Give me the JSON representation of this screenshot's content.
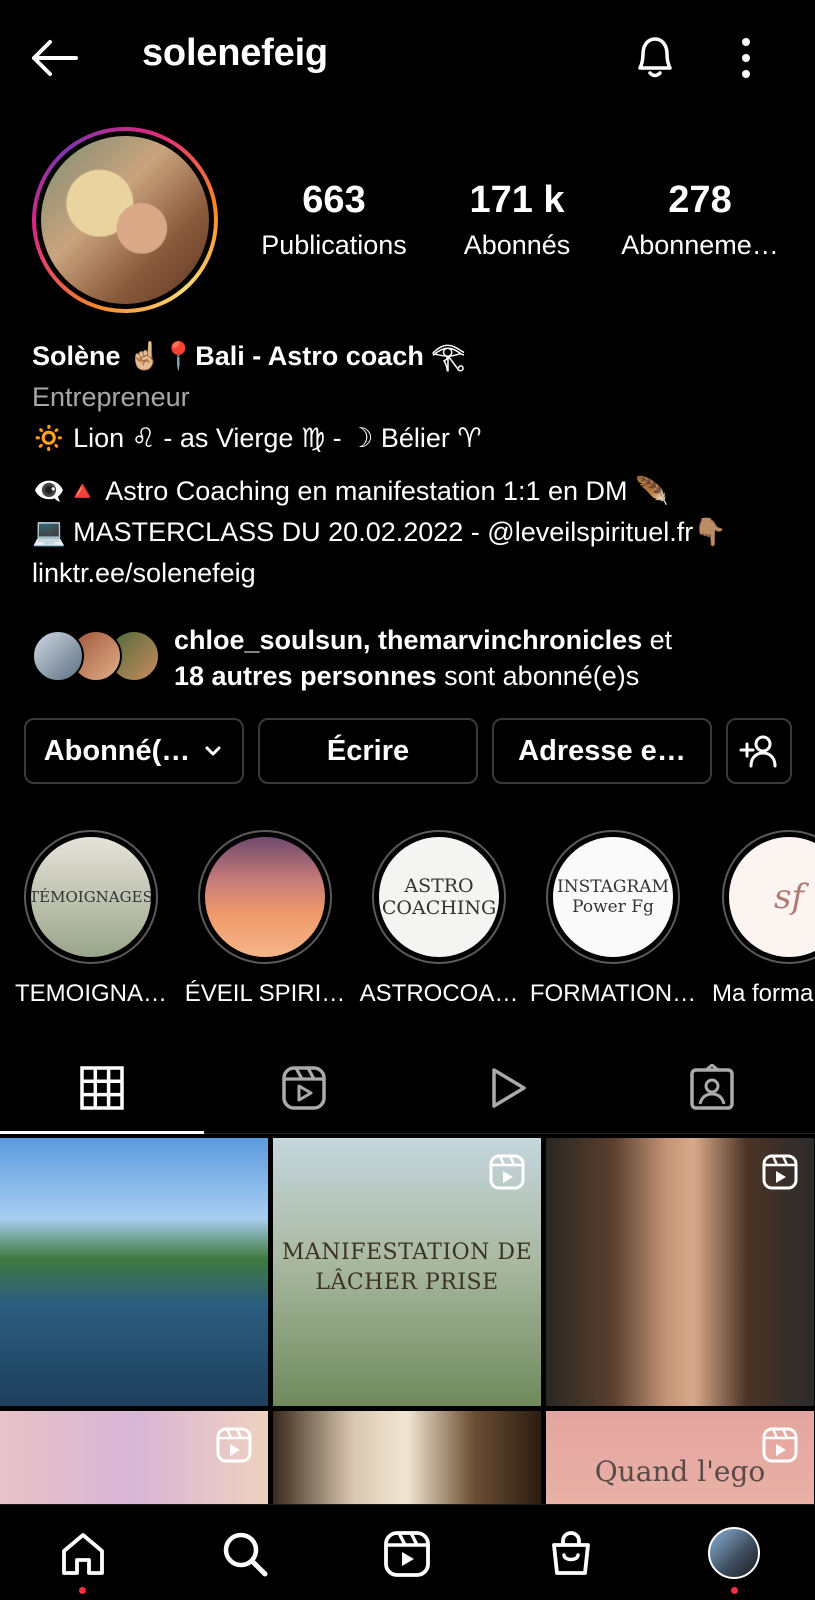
{
  "header": {
    "username": "solenefeig"
  },
  "stats": [
    {
      "value": "663",
      "label": "Publications"
    },
    {
      "value": "171 k",
      "label": "Abonnés"
    },
    {
      "value": "278",
      "label": "Abonneme…"
    }
  ],
  "bio": {
    "name": "Solène ☝🏼📍Bali - Astro coach 𓂀",
    "category": "Entrepreneur",
    "line1": "🔅 Lion ♌ - as Vierge ♍ - ☽ Bélier ♈",
    "line2": "👁‍🗨🔺 Astro Coaching en manifestation 1:1 en DM 🪶",
    "line3": "💻 MASTERCLASS DU 20.02.2022 - @leveilspirituel.fr👇🏽",
    "link": "linktr.ee/solenefeig"
  },
  "followers": {
    "names": "chloe_soulsun, themarvinchronicles",
    "joiner": " et",
    "others": "18 autres personnes",
    "suffix": " sont abonné(e)s"
  },
  "buttons": {
    "following": "Abonné(…",
    "message": "Écrire",
    "email": "Adresse e…"
  },
  "highlights": [
    {
      "label": "TEMOIGNA…",
      "cover_text": "TÉMOIGNAGES"
    },
    {
      "label": "ÉVEIL SPIRI…",
      "cover_text": ""
    },
    {
      "label": "ASTROCOA…",
      "cover_text": "ASTRO COACHING"
    },
    {
      "label": "FORMATION…",
      "cover_text": "INSTAGRAM Power Fg"
    },
    {
      "label": "Ma forma",
      "cover_text": "sf"
    }
  ],
  "posts": [
    {
      "text": ""
    },
    {
      "text": "MANIFESTATION DE LÂCHER PRISE"
    },
    {
      "text": ""
    },
    {
      "text": ""
    },
    {
      "text": ""
    },
    {
      "text": "Quand l'ego"
    }
  ],
  "icons": {
    "back": "arrow-left-icon",
    "bell": "bell-icon",
    "more": "more-vertical-icon",
    "add_person": "add-person-icon",
    "grid_tab": "grid-icon",
    "reels_tab": "reels-icon",
    "video_tab": "play-icon",
    "tagged_tab": "tagged-icon",
    "home": "home-icon",
    "search": "search-icon",
    "reels": "reels-icon",
    "shop": "shop-icon"
  },
  "colors": {
    "notification_dot": "#ff3040",
    "muted_text": "#a8a8a8",
    "button_border": "#3a3a3a"
  }
}
